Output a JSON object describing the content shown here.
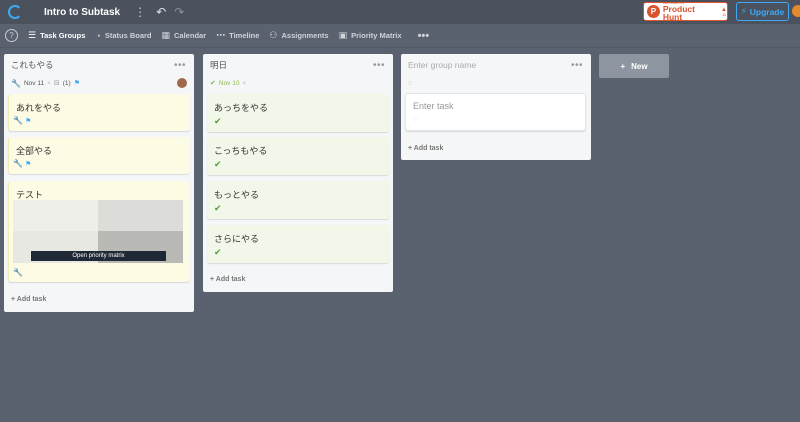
{
  "app": {
    "title": "Intro to Subtask"
  },
  "topbar": {
    "producthunt_small": "FEATURED ON",
    "producthunt_name": "Product Hunt",
    "producthunt_count": "11",
    "upgrade_label": "Upgrade"
  },
  "toolbar": {
    "tabs": [
      {
        "label": "Task Groups"
      },
      {
        "label": "Status Board"
      },
      {
        "label": "Calendar"
      },
      {
        "label": "Timeline"
      },
      {
        "label": "Assignments"
      },
      {
        "label": "Priority Matrix"
      }
    ],
    "more": "•••"
  },
  "columns": [
    {
      "name": "これもやる",
      "date": "Nov 11",
      "subtask_count": "(1)",
      "cards": [
        {
          "title": "あれをやる"
        },
        {
          "title": "全部やる"
        },
        {
          "title": "テスト",
          "caption": "Open priority matrix"
        }
      ],
      "add_task": "+ Add task"
    },
    {
      "name": "明日",
      "date": "Nov 10",
      "cards": [
        {
          "title": "あっちをやる"
        },
        {
          "title": "こっちもやる"
        },
        {
          "title": "もっとやる"
        },
        {
          "title": "さらにやる"
        }
      ],
      "add_task": "+ Add task"
    },
    {
      "name_placeholder": "Enter group name",
      "task_placeholder": "Enter task",
      "add_task": "+ Add task"
    }
  ],
  "new_button": {
    "label": "New"
  },
  "colors": {
    "background": "#5a6270",
    "accent": "#3fa9f5",
    "producthunt": "#da552f",
    "yellow_card": "#fdfbe3",
    "green_card": "#f1f8e9"
  }
}
